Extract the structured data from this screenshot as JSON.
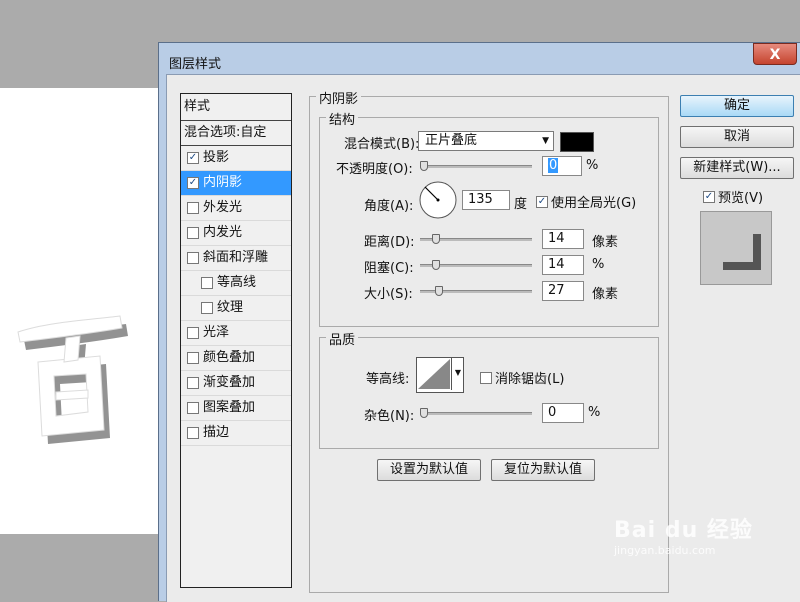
{
  "dialog": {
    "title": "图层样式",
    "close": "X"
  },
  "sidebar": {
    "header": "样式",
    "blend_options": "混合选项:自定",
    "items": [
      {
        "label": "投影",
        "checked": true,
        "selected": false,
        "sub": false
      },
      {
        "label": "内阴影",
        "checked": true,
        "selected": true,
        "sub": false
      },
      {
        "label": "外发光",
        "checked": false,
        "selected": false,
        "sub": false
      },
      {
        "label": "内发光",
        "checked": false,
        "selected": false,
        "sub": false
      },
      {
        "label": "斜面和浮雕",
        "checked": false,
        "selected": false,
        "sub": false
      },
      {
        "label": "等高线",
        "checked": false,
        "selected": false,
        "sub": true
      },
      {
        "label": "纹理",
        "checked": false,
        "selected": false,
        "sub": true
      },
      {
        "label": "光泽",
        "checked": false,
        "selected": false,
        "sub": false
      },
      {
        "label": "颜色叠加",
        "checked": false,
        "selected": false,
        "sub": false
      },
      {
        "label": "渐变叠加",
        "checked": false,
        "selected": false,
        "sub": false
      },
      {
        "label": "图案叠加",
        "checked": false,
        "selected": false,
        "sub": false
      },
      {
        "label": "描边",
        "checked": false,
        "selected": false,
        "sub": false
      }
    ]
  },
  "panel": {
    "section_title": "内阴影",
    "structure": {
      "title": "结构",
      "blend_mode_label": "混合模式(B):",
      "blend_mode_value": "正片叠底",
      "blend_color": "#000000",
      "opacity_label": "不透明度(O):",
      "opacity_value": "0",
      "opacity_unit": "%",
      "angle_label": "角度(A):",
      "angle_value": "135",
      "angle_unit": "度",
      "global_light_label": "使用全局光(G)",
      "global_light_checked": true,
      "distance_label": "距离(D):",
      "distance_value": "14",
      "distance_unit": "像素",
      "choke_label": "阻塞(C):",
      "choke_value": "14",
      "choke_unit": "%",
      "size_label": "大小(S):",
      "size_value": "27",
      "size_unit": "像素"
    },
    "quality": {
      "title": "品质",
      "contour_label": "等高线:",
      "antialias_label": "消除锯齿(L)",
      "antialias_checked": false,
      "noise_label": "杂色(N):",
      "noise_value": "0",
      "noise_unit": "%"
    },
    "make_default": "设置为默认值",
    "reset_default": "复位为默认值"
  },
  "buttons": {
    "ok": "确定",
    "cancel": "取消",
    "new_style": "新建样式(W)...",
    "preview_label": "预览(V)",
    "preview_checked": true
  },
  "canvas": {
    "glyph": "百"
  },
  "watermark": {
    "brand": "Bai du 经验",
    "url": "jingyan.baidu.com"
  }
}
